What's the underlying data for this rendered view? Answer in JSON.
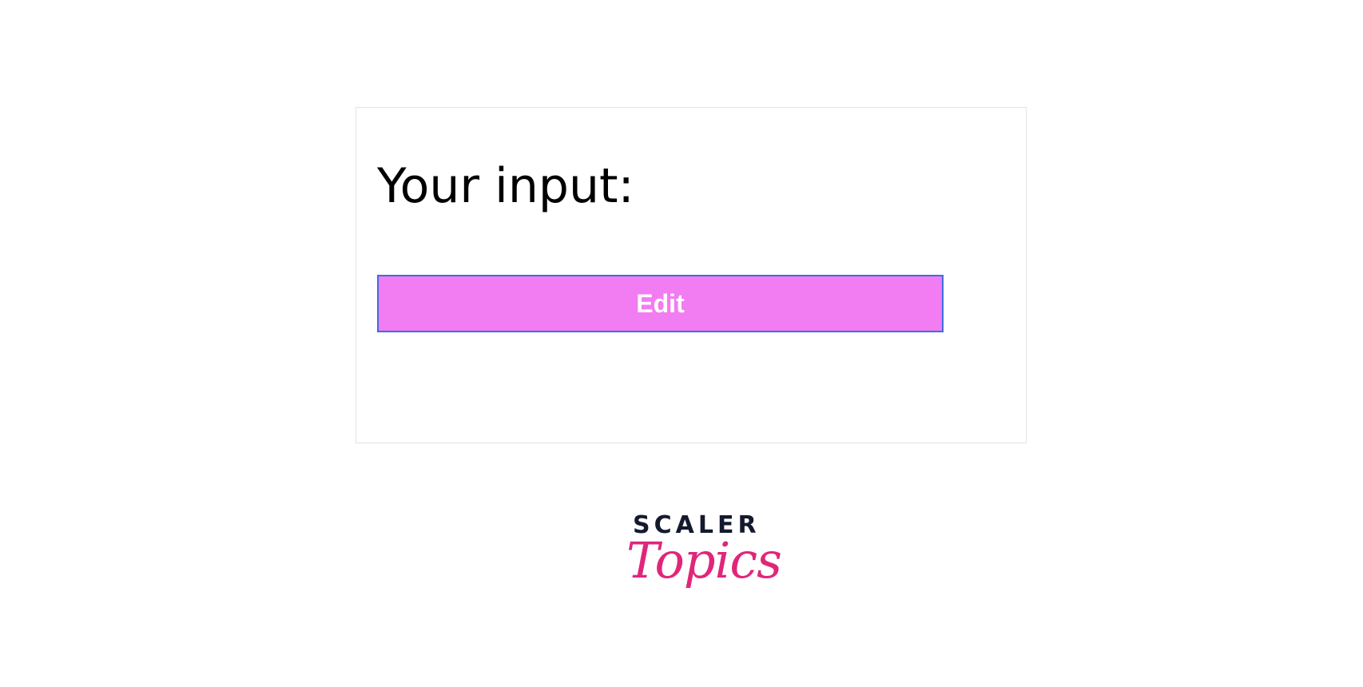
{
  "prompt": {
    "heading": "Your input:"
  },
  "actions": {
    "edit_label": "Edit"
  },
  "brand": {
    "line1": "SCALER",
    "line2": "Topics"
  },
  "colors": {
    "button_background": "#f27cf2",
    "button_border": "#3b6fe0",
    "brand_dark": "#141a2e",
    "brand_pink": "#e0267a"
  }
}
